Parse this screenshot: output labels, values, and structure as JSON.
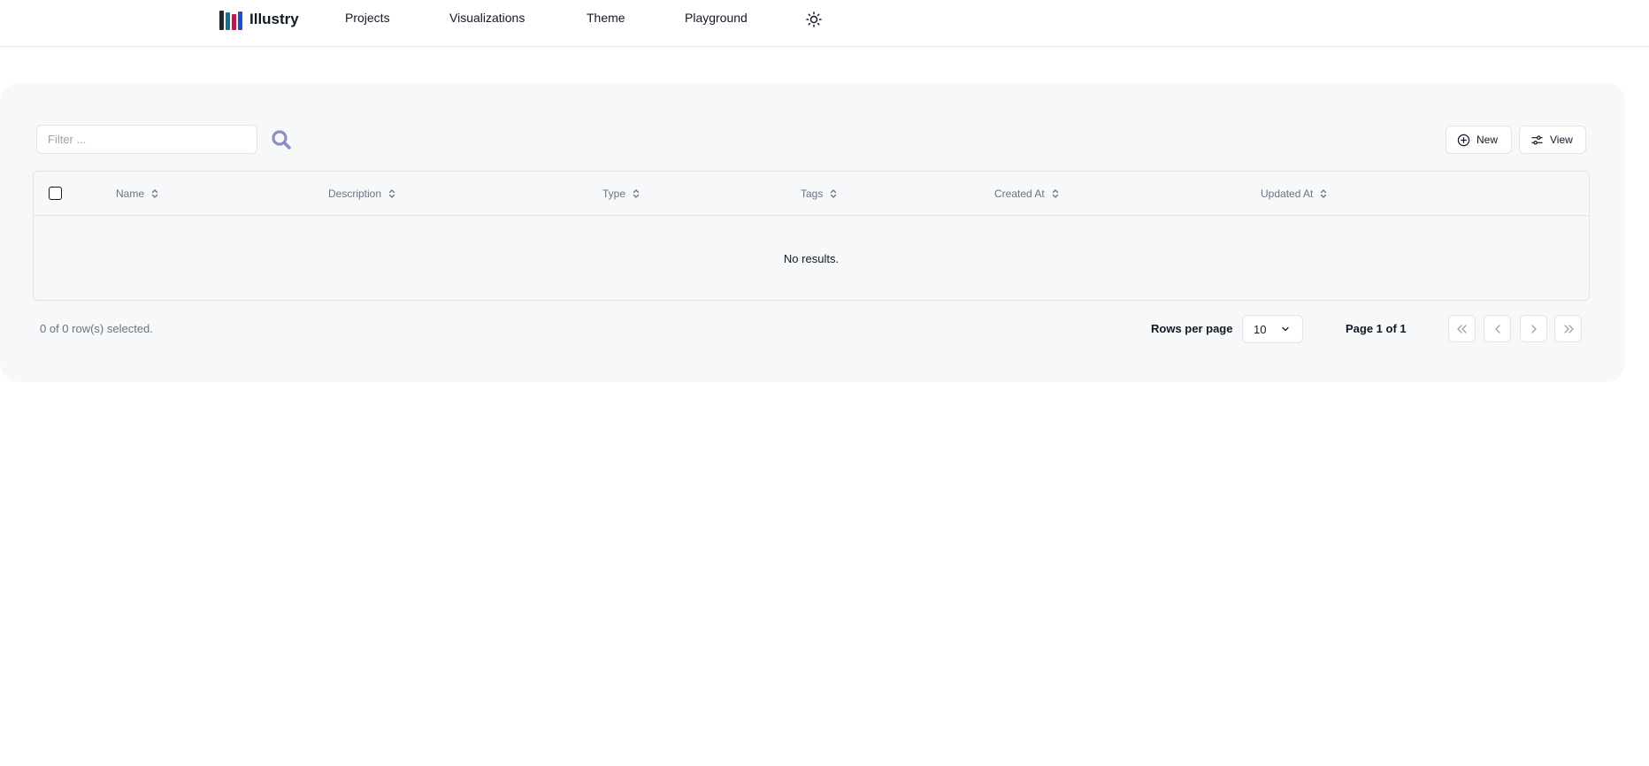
{
  "nav": {
    "brand": "Illustry",
    "items": [
      "Projects",
      "Visualizations",
      "Theme",
      "Playground"
    ],
    "theme_toggle_icon": "sun-icon"
  },
  "toolbar": {
    "filter_placeholder": "Filter ...",
    "filter_value": "",
    "search_icon": "search-icon",
    "new_label": "New",
    "view_label": "View"
  },
  "table": {
    "columns": [
      "Name",
      "Description",
      "Type",
      "Tags",
      "Created At",
      "Updated At"
    ],
    "rows": [],
    "empty_text": "No results."
  },
  "footer": {
    "selected_text": "0 of 0 row(s) selected.",
    "rows_per_page_label": "Rows per page",
    "rows_per_page_value": "10",
    "page_text": "Page 1 of 1"
  },
  "colors": {
    "card_bg": "#f7f8fa",
    "border": "#e2e4e8",
    "search_icon": "#8b8fc7",
    "muted_text": "#6b7280"
  }
}
